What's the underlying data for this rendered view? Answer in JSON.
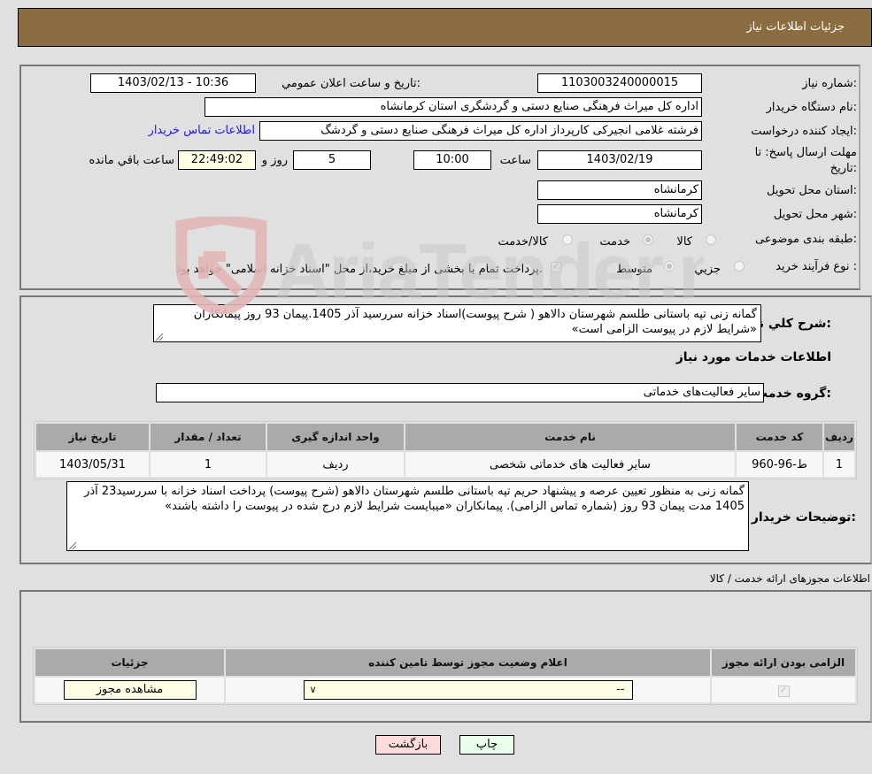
{
  "header": {
    "title": "جزئیات اطلاعات نیاز"
  },
  "details": {
    "need_number_label": "شماره نیاز:",
    "need_number": "1103003240000015",
    "announce_label": "تاریخ و ساعت اعلان عمومي:",
    "announce_value": "1403/02/13 - 10:36",
    "buyer_org_label": "نام دستگاه خریدار:",
    "buyer_org": "اداره کل میراث فرهنگی  صنایع دستی و گردشگری استان کرمانشاه",
    "creator_label": "ایجاد کننده درخواست:",
    "creator": "فرشته غلامی انجیرکی کارپرداز اداره کل میراث فرهنگی  صنایع دستی و گردشگ",
    "contact_link": "اطلاعات تماس خریدار",
    "deadline_label_line1": "مهلت ارسال پاسخ: تا",
    "deadline_label_line2": "تاریخ:",
    "deadline_date": "1403/02/19",
    "time_label": "ساعت",
    "deadline_time": "10:00",
    "days_value": "5",
    "days_label": "روز و",
    "remaining_time": "22:49:02",
    "remaining_label": "ساعت باقي مانده",
    "province_label": "استان محل تحویل:",
    "province": "کرمانشاه",
    "city_label": "شهر محل تحویل:",
    "city": "کرمانشاه",
    "category_label": "طبقه بندی موضوعی:",
    "category_options": [
      {
        "label": "کالا",
        "selected": false
      },
      {
        "label": "خدمت",
        "selected": true
      },
      {
        "label": "کالا/خدمت",
        "selected": false
      }
    ],
    "process_label": "نوع فرآیند خرید :",
    "process_options": [
      {
        "label": "جزيي",
        "selected": false
      },
      {
        "label": "متوسط",
        "selected": true
      }
    ],
    "treasury_note": "پرداخت تمام یا بخشی از مبلغ خرید،از محل \"اسناد خزانه اسلامی\" خواهد بود.",
    "treasury_checked": true
  },
  "description": {
    "label": "شرح کلي نیاز:",
    "text": "گمانه زنی تپه باستانی طلسم شهرستان دالاهو ( شرح پیوست)اسناد خزانه سررسید آذر 1405.پیمان 93 روز پیمانکاران «شرایط لازم در پیوست الزامی است»"
  },
  "services": {
    "section_title": "اطلاعات خدمات مورد نیاز",
    "group_label": "گروه خدمت:",
    "group_value": "سایر فعالیت‌های خدماتی",
    "columns": [
      "ردیف",
      "کد خدمت",
      "نام خدمت",
      "واحد اندازه گیری",
      "تعداد / مقدار",
      "تاریخ نیاز"
    ],
    "rows": [
      [
        "1",
        "ط-96-960",
        "سایر فعالیت های خدماتی شخصی",
        "ردیف",
        "1",
        "1403/05/31"
      ]
    ]
  },
  "buyer_notes": {
    "label": "توضیحات خریدار:",
    "text": "گمانه زنی به منظور تعیین عرصه و پیشنهاد حریم تپه باستانی طلسم شهرستان دالاهو (شرح پیوست) پرداخت  اسناد خزانه با سررسید23 آذر 1405 مدت پیمان 93 روز (شماره تماس الزامی). پیمانکاران «میبایست شرایط لازم درج شده در پیوست را داشته باشند»"
  },
  "permits": {
    "section_title": "اطلاعات مجوزهای ارائه خدمت / کالا",
    "columns": [
      "الزامی بودن ارائه مجوز",
      "اعلام وضعیت مجوز توسط تامین کننده",
      "جزئیات"
    ],
    "row": {
      "required_checked": true,
      "status_selected": "--",
      "details_button": "مشاهده مجوز"
    }
  },
  "footer": {
    "print_button": "چاپ",
    "back_button": "بازگشت"
  },
  "watermark": {
    "text": "AriaTender.neT"
  },
  "colors": {
    "title_bar": "#8b6d42",
    "print_bg": "#eaffea",
    "back_bg": "#ffdcdc",
    "yellow_field": "#ffffe6",
    "link": "#1a1aee"
  }
}
